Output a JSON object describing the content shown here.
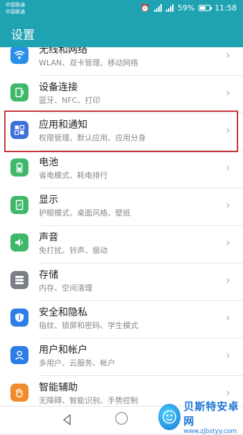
{
  "statusbar": {
    "carrier1": "中国联通",
    "carrier2": "中国联通",
    "battery_percent": "59%",
    "time": "11:58",
    "icons": [
      "alarm-icon",
      "4g-signal-icon",
      "signal-icon",
      "battery-icon"
    ],
    "battery_level": 0.59
  },
  "header": {
    "title": "设置"
  },
  "items": [
    {
      "title": "无线和网络",
      "subtitle": "WLAN、双卡管理、移动网络",
      "icon": "wifi-icon",
      "color": "#2b8fe8"
    },
    {
      "title": "设备连接",
      "subtitle": "蓝牙、NFC、打印",
      "icon": "device-connection-icon",
      "color": "#3fb86a"
    },
    {
      "title": "应用和通知",
      "subtitle": "权限管理、默认应用、应用分身",
      "icon": "apps-icon",
      "color": "#3f6fd8"
    },
    {
      "title": "电池",
      "subtitle": "省电模式、耗电排行",
      "icon": "battery-icon",
      "color": "#3fb86a"
    },
    {
      "title": "显示",
      "subtitle": "护眼模式、桌面风格、壁纸",
      "icon": "display-icon",
      "color": "#3fb86a"
    },
    {
      "title": "声音",
      "subtitle": "免打扰、铃声、振动",
      "icon": "sound-icon",
      "color": "#3fb86a"
    },
    {
      "title": "存储",
      "subtitle": "内存、空间清理",
      "icon": "storage-icon",
      "color": "#7a7f87"
    },
    {
      "title": "安全和隐私",
      "subtitle": "指纹、锁屏和密码、学生模式",
      "icon": "shield-icon",
      "color": "#2d7de6"
    },
    {
      "title": "用户和帐户",
      "subtitle": "多用户、云服务、帐户",
      "icon": "user-icon",
      "color": "#2d7de6"
    },
    {
      "title": "智能辅助",
      "subtitle": "无障碍、智能识别、手势控制",
      "icon": "hand-icon",
      "color": "#f08a2c"
    }
  ],
  "watermark": {
    "name": "贝斯特安卓网",
    "url": "www.zjbstyy.com"
  }
}
